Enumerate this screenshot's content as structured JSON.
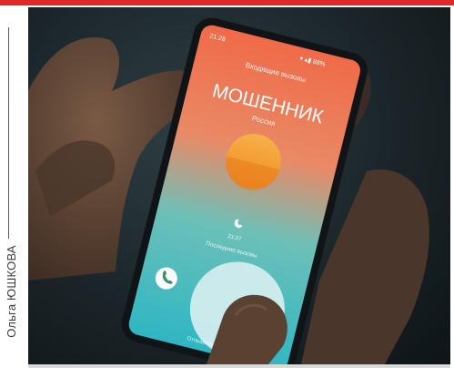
{
  "credit": "Ольга ЮШКОВА",
  "phone": {
    "status_time": "21:28",
    "status_right": "▾ ▴▮ 88%",
    "screen_title": "Входящие вызовы",
    "caller_name": "МОШЕННИК",
    "caller_location": "Россия",
    "call_time": "21:27",
    "recent_calls_label": "Последние вызовы",
    "bottom_hint": "Отправить сообщение"
  },
  "colors": {
    "accent_red": "#e3262a",
    "screen_top": "#f06a48",
    "screen_bottom": "#2fb6c3",
    "avatar": "#f49b2c",
    "answer_button": "#3a8f6a"
  },
  "icons": {
    "answer": "phone-icon",
    "call_history": "phone-icon"
  }
}
